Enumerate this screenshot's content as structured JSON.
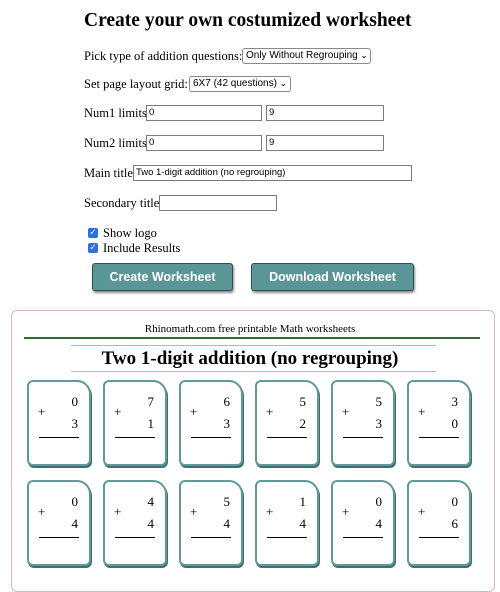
{
  "header": {
    "title": "Create your own costumized worksheet"
  },
  "form": {
    "type_label": "Pick type of addition questions:",
    "type_value": "Only Without Regrouping",
    "layout_label": "Set page layout grid:",
    "layout_value": "6X7 (42 questions)",
    "num1_label": "Num1 limits",
    "num1_min": "0",
    "num1_max": "9",
    "num2_label": "Num2 limits",
    "num2_min": "0",
    "num2_max": "9",
    "main_title_label": "Main title",
    "main_title_value": "Two 1-digit addition (no regrouping)",
    "secondary_title_label": "Secondary title",
    "secondary_title_value": "",
    "show_logo_label": "Show logo",
    "show_logo_checked": true,
    "include_results_label": "Include Results",
    "include_results_checked": true,
    "create_button": "Create Worksheet",
    "download_button": "Download Worksheet"
  },
  "worksheet": {
    "site_header": "Rhinomath.com free printable Math worksheets",
    "title": "Two 1-digit addition (no regrouping)",
    "operator": "+",
    "problems": [
      {
        "top": "0",
        "bottom": "3"
      },
      {
        "top": "7",
        "bottom": "1"
      },
      {
        "top": "6",
        "bottom": "3"
      },
      {
        "top": "5",
        "bottom": "2"
      },
      {
        "top": "5",
        "bottom": "3"
      },
      {
        "top": "3",
        "bottom": "0"
      },
      {
        "top": "0",
        "bottom": "4"
      },
      {
        "top": "4",
        "bottom": "4"
      },
      {
        "top": "5",
        "bottom": "4"
      },
      {
        "top": "1",
        "bottom": "4"
      },
      {
        "top": "0",
        "bottom": "4"
      },
      {
        "top": "0",
        "bottom": "6"
      }
    ]
  },
  "colors": {
    "button_bg": "#5a9597",
    "card_border": "#5f9a9a",
    "header_rule": "#2f6b2f",
    "page_border": "#d9b8c4",
    "checkbox": "#2f6fdc"
  }
}
